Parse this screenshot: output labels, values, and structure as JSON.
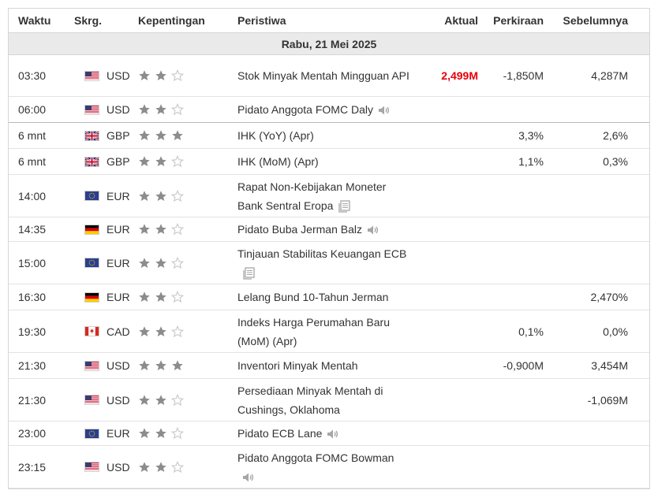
{
  "headers": {
    "time": "Waktu",
    "currency": "Skrg.",
    "importance": "Kepentingan",
    "event": "Peristiwa",
    "actual": "Aktual",
    "forecast": "Perkiraan",
    "previous": "Sebelumnya"
  },
  "date_label": "Rabu, 21 Mei 2025",
  "colors": {
    "star_filled": "#8c8c8c",
    "star_empty": "#c8c8c8",
    "actual_highlight": "#e4000a"
  },
  "rows": [
    {
      "time": "03:30",
      "flag": "us-flag-icon",
      "currency": "USD",
      "stars": 2,
      "event": "Stok Minyak Mentah Mingguan API",
      "icon": null,
      "actual": "2,499M",
      "forecast": "-1,850M",
      "previous": "4,287M"
    },
    {
      "time": "06:00",
      "flag": "us-flag-icon",
      "currency": "USD",
      "stars": 2,
      "event": "Pidato Anggota FOMC Daly",
      "icon": "speaker-icon",
      "actual": "",
      "forecast": "",
      "previous": ""
    },
    {
      "time": "6 mnt",
      "flag": "gb-flag-icon",
      "currency": "GBP",
      "stars": 3,
      "event": "IHK (YoY) (Apr)",
      "icon": null,
      "actual": "",
      "forecast": "3,3%",
      "previous": "2,6%"
    },
    {
      "time": "6 mnt",
      "flag": "gb-flag-icon",
      "currency": "GBP",
      "stars": 2,
      "event": "IHK (MoM) (Apr)",
      "icon": null,
      "actual": "",
      "forecast": "1,1%",
      "previous": "0,3%"
    },
    {
      "time": "14:00",
      "flag": "eu-flag-icon",
      "currency": "EUR",
      "stars": 2,
      "event": "Rapat Non-Kebijakan Moneter Bank Sentral Eropa",
      "icon": "document-icon",
      "actual": "",
      "forecast": "",
      "previous": ""
    },
    {
      "time": "14:35",
      "flag": "de-flag-icon",
      "currency": "EUR",
      "stars": 2,
      "event": "Pidato Buba Jerman Balz",
      "icon": "speaker-icon",
      "actual": "",
      "forecast": "",
      "previous": ""
    },
    {
      "time": "15:00",
      "flag": "eu-flag-icon",
      "currency": "EUR",
      "stars": 2,
      "event": "Tinjauan Stabilitas Keuangan ECB",
      "icon": "document-icon",
      "actual": "",
      "forecast": "",
      "previous": ""
    },
    {
      "time": "16:30",
      "flag": "de-flag-icon",
      "currency": "EUR",
      "stars": 2,
      "event": "Lelang Bund 10-Tahun Jerman",
      "icon": null,
      "actual": "",
      "forecast": "",
      "previous": "2,470%"
    },
    {
      "time": "19:30",
      "flag": "ca-flag-icon",
      "currency": "CAD",
      "stars": 2,
      "event": "Indeks Harga Perumahan Baru (MoM) (Apr)",
      "icon": null,
      "actual": "",
      "forecast": "0,1%",
      "previous": "0,0%"
    },
    {
      "time": "21:30",
      "flag": "us-flag-icon",
      "currency": "USD",
      "stars": 3,
      "event": "Inventori Minyak Mentah",
      "icon": null,
      "actual": "",
      "forecast": "-0,900M",
      "previous": "3,454M"
    },
    {
      "time": "21:30",
      "flag": "us-flag-icon",
      "currency": "USD",
      "stars": 2,
      "event": "Persediaan Minyak Mentah di Cushings, Oklahoma",
      "icon": null,
      "actual": "",
      "forecast": "",
      "previous": "-1,069M"
    },
    {
      "time": "23:00",
      "flag": "eu-flag-icon",
      "currency": "EUR",
      "stars": 2,
      "event": "Pidato ECB Lane",
      "icon": "speaker-icon",
      "actual": "",
      "forecast": "",
      "previous": ""
    },
    {
      "time": "23:15",
      "flag": "us-flag-icon",
      "currency": "USD",
      "stars": 2,
      "event": "Pidato Anggota FOMC Bowman",
      "icon": "speaker-icon",
      "actual": "",
      "forecast": "",
      "previous": ""
    }
  ]
}
